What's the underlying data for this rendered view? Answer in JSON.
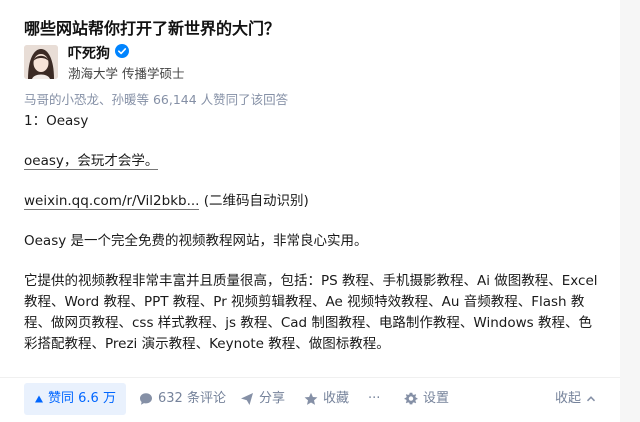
{
  "question": {
    "title": "哪些网站帮你打开了新世界的大门？"
  },
  "author": {
    "name": "吓死狗",
    "bio": "渤海大学 传播学硕士",
    "verified_icon": "verified-badge-icon"
  },
  "vote_summary": "马哥的小恐龙、孙暖等 66,144 人赞同了该回答",
  "content": {
    "p1": "1：Oeasy",
    "p2": "oeasy，会玩才会学。",
    "p3_link": "weixin.qq.com/r/Vil2bkb...",
    "p3_note": " (二维码自动识别)",
    "p4": "Oeasy 是一个完全免费的视频教程网站，非常良心实用。",
    "p5": "它提供的视频教程非常丰富并且质量很高，包括：PS 教程、手机摄影教程、Ai 做图教程、Excel 教程、Word 教程、PPT 教程、Pr 视频剪辑教程、Ae 视频特效教程、Au 音频教程、Flash 教程、做网页教程、css 样式教程、js 教程、Cad 制图教程、电路制作教程、Windows 教程、色彩搭配教程、Prezi 演示教程、Keynote 教程、做图标教程。"
  },
  "actions": {
    "vote": "赞同 6.6 万",
    "comments": "632 条评论",
    "share": "分享",
    "favorite": "收藏",
    "more": "···",
    "settings": "设置",
    "collapse": "收起"
  },
  "colors": {
    "accent": "#0066ff",
    "accent_bg": "#e9f1fd",
    "muted": "#8590a6"
  }
}
